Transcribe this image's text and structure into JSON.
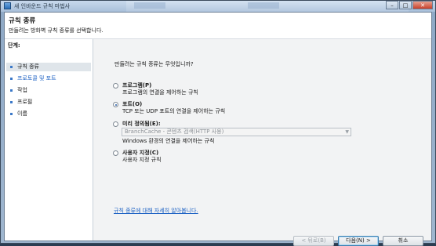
{
  "window": {
    "title": "새 인바운드 규칙 마법사"
  },
  "header": {
    "title": "규칙 종류",
    "subtitle": "만들려는 방화벽 규칙 종류를 선택합니다."
  },
  "steps": {
    "label": "단계:",
    "items": [
      {
        "label": "규칙 종류"
      },
      {
        "label": "프로토콜 및 포트"
      },
      {
        "label": "작업"
      },
      {
        "label": "프로필"
      },
      {
        "label": "이름"
      }
    ]
  },
  "content": {
    "question": "만들려는 규칙 종류는 무엇입니까?",
    "options": [
      {
        "title": "프로그램(P)",
        "description": "프로그램의 연결을 제어하는 규칙",
        "checked": false
      },
      {
        "title": "포트(O)",
        "description": "TCP 또는 UDP 포트의 연결을 제어하는 규칙",
        "checked": true
      },
      {
        "title": "미리 정의됨(E):",
        "description": "Windows 환경의 연결을 제어하는 규칙",
        "checked": false
      },
      {
        "title": "사용자 지정(C)",
        "description": "사용자 지정 규칙",
        "checked": false
      }
    ],
    "predefined_select_value": "BranchCache - 콘텐츠 검색(HTTP 사용)",
    "help_link": "규칙 종류에 대해 자세히 알아봅니다."
  },
  "buttons": {
    "back": "< 뒤로(B)",
    "next": "다음(N) >",
    "cancel": "취소"
  }
}
